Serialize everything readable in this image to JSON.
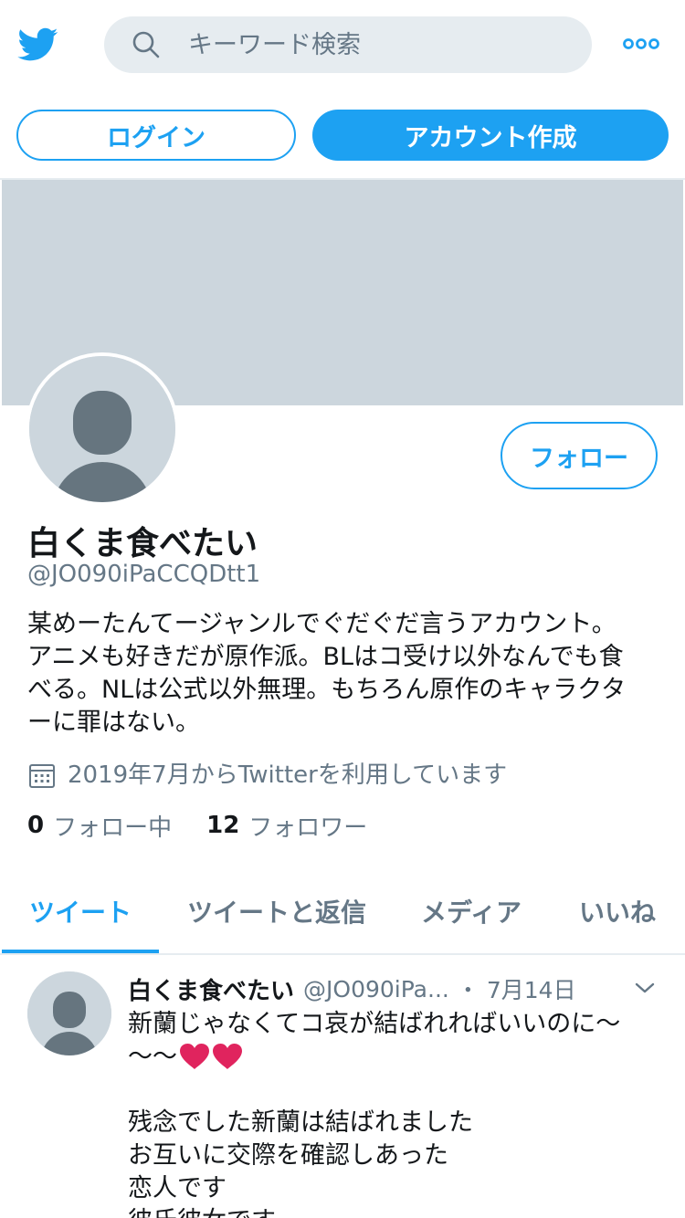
{
  "header": {
    "search_placeholder": "キーワード検索",
    "login_label": "ログイン",
    "signup_label": "アカウント作成"
  },
  "profile": {
    "follow_label": "フォロー",
    "name": "白くま食べたい",
    "handle": "@JO090iPaCCQDtt1",
    "bio_lines": [
      "某めーたんてージャンルでぐだぐだ言うアカウント。",
      "アニメも好きだが原作派。BLはコ受け以外なんでも食",
      "べる。NLは公式以外無理。もちろん原作のキャラクタ",
      "ーに罪はない。"
    ],
    "joined": "2019年7月からTwitterを利用しています",
    "following_count": "0",
    "following_label": "フォロー中",
    "followers_count": "12",
    "followers_label": "フォロワー"
  },
  "tabs": [
    {
      "label": "ツイート",
      "active": true
    },
    {
      "label": "ツイートと返信",
      "active": false
    },
    {
      "label": "メディア",
      "active": false
    },
    {
      "label": "いいね",
      "active": false
    }
  ],
  "tweet": {
    "name": "白くま食べたい",
    "handle": "@JO090iPa...",
    "separator": "・",
    "date": "7月14日",
    "lines": [
      "新蘭じゃなくてコ哀が結ばれればいいのに～",
      "～～",
      "",
      "残念でした新蘭は結ばれました",
      "お互いに交際を確認しあった",
      "恋人です",
      "彼氏彼女です"
    ]
  },
  "colors": {
    "accent": "#1da1f2",
    "banner": "#ccd6dd",
    "secondary_text": "#657786",
    "heart": "#e0245e"
  },
  "icons": [
    "twitter-bird-icon",
    "search-icon",
    "more-dots-icon",
    "calendar-icon",
    "chevron-down-icon",
    "heart-emoji-icon"
  ]
}
